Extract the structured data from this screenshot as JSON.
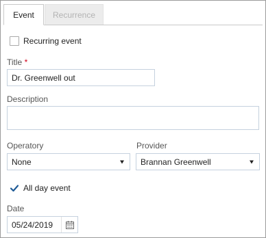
{
  "tabs": [
    {
      "label": "Event",
      "active": true
    },
    {
      "label": "Recurrence",
      "active": false
    }
  ],
  "recurring": {
    "label": "Recurring event",
    "checked": false
  },
  "title": {
    "label": "Title",
    "required_marker": "*",
    "value": "Dr. Greenwell out"
  },
  "description": {
    "label": "Description",
    "value": ""
  },
  "operatory": {
    "label": "Operatory",
    "value": "None"
  },
  "provider": {
    "label": "Provider",
    "value": "Brannan Greenwell"
  },
  "all_day": {
    "label": "All day event",
    "checked": true
  },
  "date": {
    "label": "Date",
    "value": "05/24/2019"
  },
  "colors": {
    "check_blue": "#1e5a96",
    "required_red": "#d0021b",
    "field_border": "#c5d1de"
  }
}
